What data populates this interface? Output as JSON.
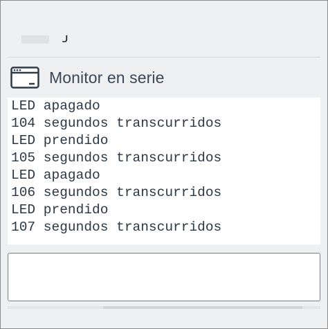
{
  "panel": {
    "title": "Monitor en serie",
    "icon": "serial-monitor-window-icon"
  },
  "output": {
    "lines": [
      "LED apagado",
      "104 segundos transcurridos",
      "LED prendido",
      "105 segundos transcurridos",
      "LED apagado",
      "106 segundos transcurridos",
      "LED prendido",
      "107 segundos transcurridos"
    ]
  },
  "input": {
    "value": "",
    "placeholder": ""
  },
  "colors": {
    "background": "#eef0f2",
    "output_background": "#ffffff",
    "text": "#2c3744",
    "title": "#3a4856"
  }
}
